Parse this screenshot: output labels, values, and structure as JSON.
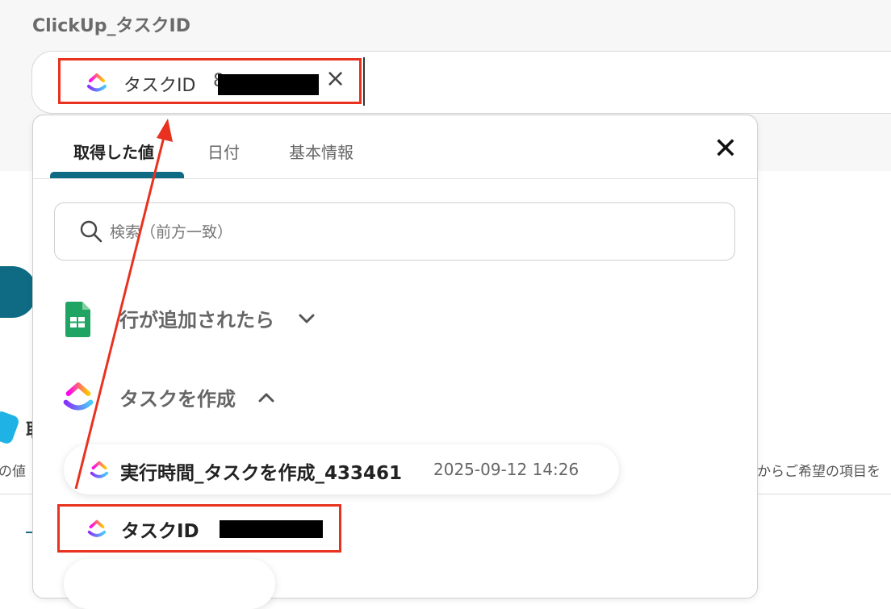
{
  "field": {
    "label": "ClickUp_タスクID",
    "chip_label": "タスクID",
    "chip_value_prefix": "8",
    "chip_remove": "×"
  },
  "dropdown": {
    "tabs": [
      {
        "label": "取得した値",
        "active": true
      },
      {
        "label": "日付",
        "active": false
      },
      {
        "label": "基本情報",
        "active": false
      }
    ],
    "close": "✕",
    "search": {
      "placeholder": "検索（前方一致）"
    },
    "sections": [
      {
        "title": "行が追加されたら",
        "icon": "google-sheets-icon",
        "expanded": false
      },
      {
        "title": "タスクを作成",
        "icon": "clickup-icon",
        "expanded": true
      }
    ],
    "items": [
      {
        "label": "実行時間_タスクを作成_433461",
        "timestamp": "2025-09-12 14:26"
      },
      {
        "label": "タスクID",
        "value": ""
      }
    ]
  },
  "background": {
    "left_text": "の値",
    "right_text": "からご希望の項目を",
    "bold_char": "取"
  },
  "colors": {
    "accent": "#0f6b84",
    "highlight": "#e8321f",
    "sheets_green": "#1fa463"
  }
}
